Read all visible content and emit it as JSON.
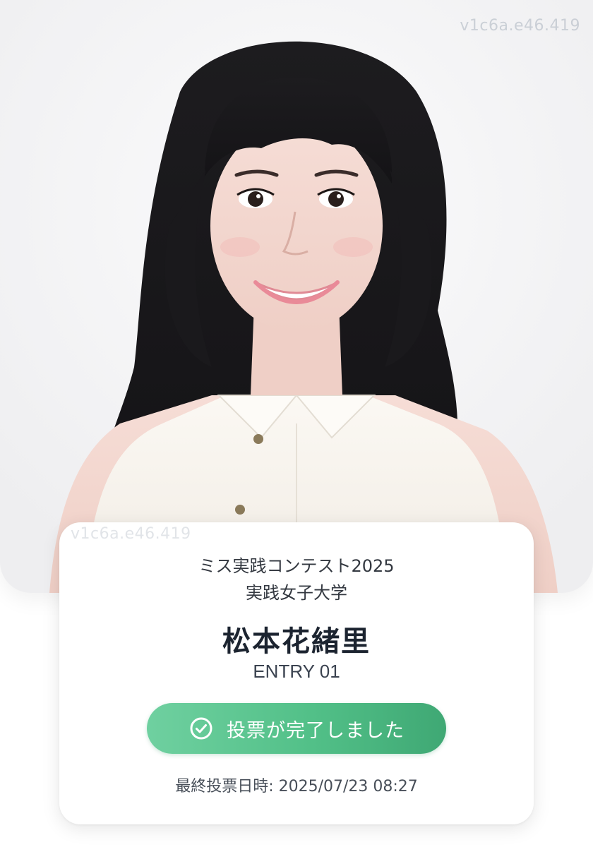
{
  "watermark": {
    "top_text": "v1c6a.e46.419",
    "card_text": "v1c6a.e46.419"
  },
  "card": {
    "contest_title": "ミス実践コンテスト2025",
    "university": "実践女子大学",
    "name": "松本花緒里",
    "entry": "ENTRY 01",
    "vote_button": {
      "label": "投票が完了しました",
      "icon": "check-circle-icon",
      "gradient": [
        "#6fd0a0",
        "#3fa874"
      ]
    },
    "last_vote_label": "最終投票日時:",
    "last_vote_value": "2025/07/23 08:27"
  }
}
